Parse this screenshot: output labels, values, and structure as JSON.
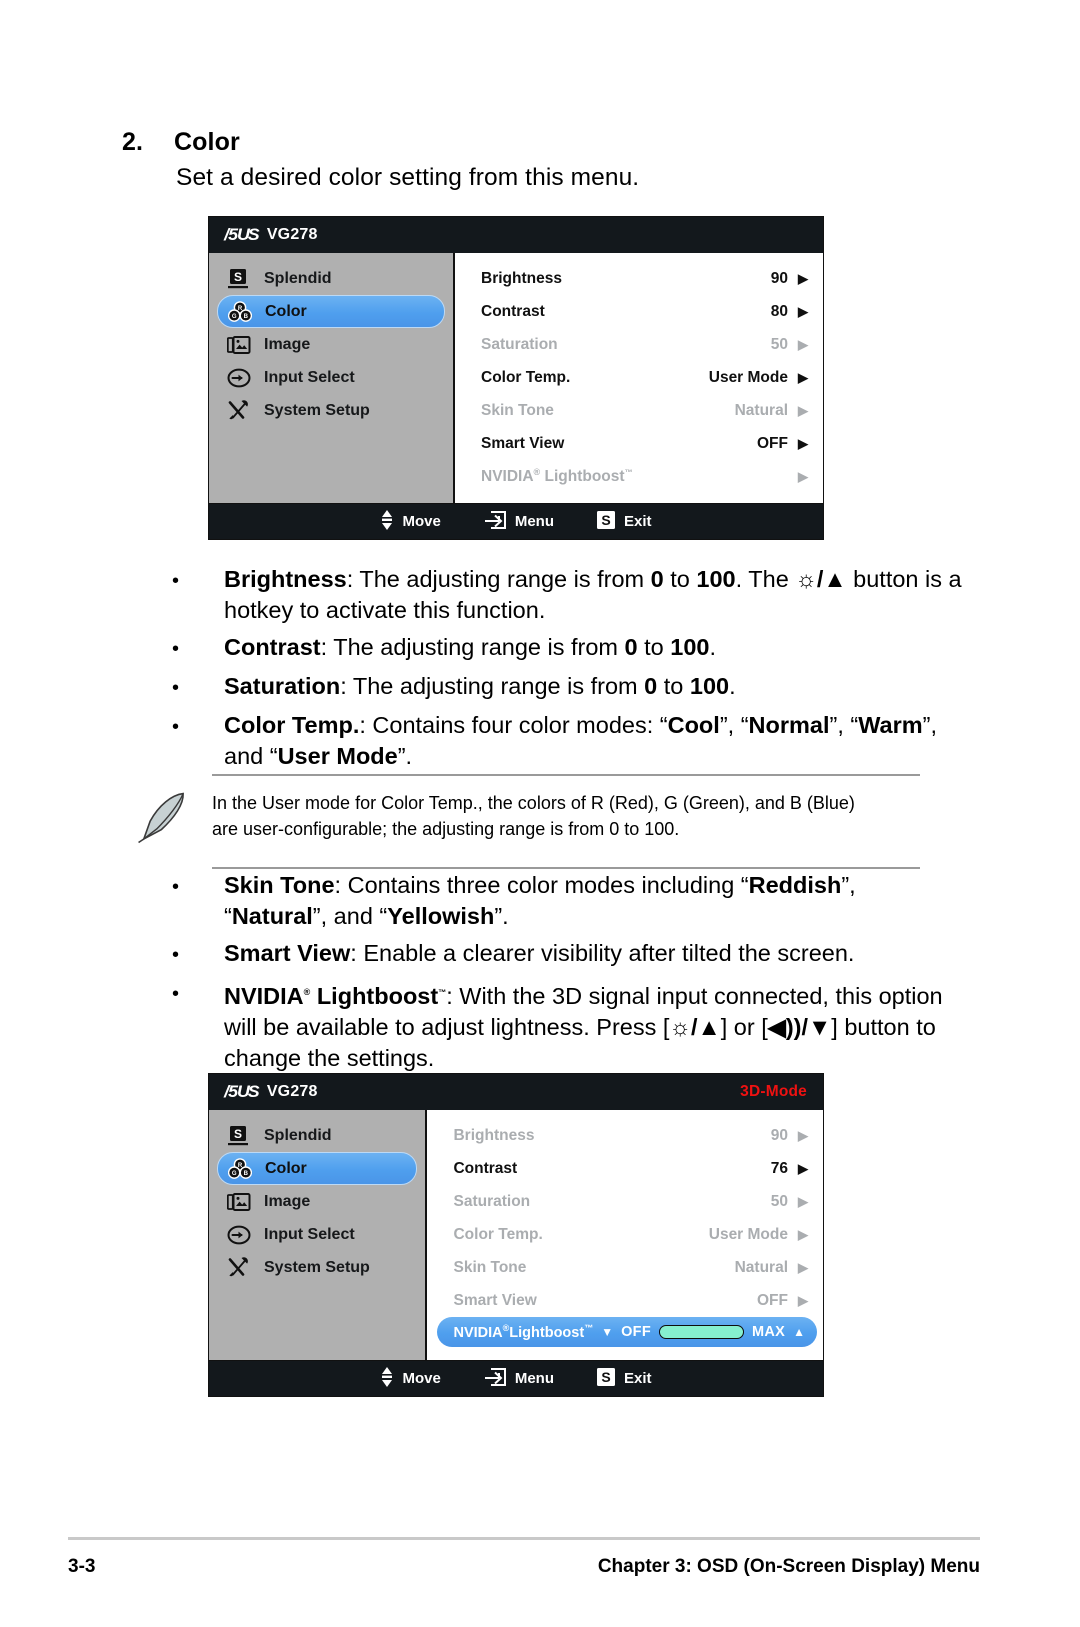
{
  "section": {
    "number": "2.",
    "title": "Color",
    "subtitle": "Set a desired color setting from this menu."
  },
  "osd_menu_1": {
    "brand": "/5US",
    "model": "VG278",
    "mode_badge": "",
    "sidebar": [
      {
        "label": "Splendid",
        "icon": "splendid-icon",
        "active": false
      },
      {
        "label": "Color",
        "icon": "color-icon",
        "active": true
      },
      {
        "label": "Image",
        "icon": "image-icon",
        "active": false
      },
      {
        "label": "Input Select",
        "icon": "input-select-icon",
        "active": false
      },
      {
        "label": "System Setup",
        "icon": "system-setup-icon",
        "active": false
      }
    ],
    "rows": [
      {
        "label": "Brightness",
        "value": "90",
        "dim": false
      },
      {
        "label": "Contrast",
        "value": "80",
        "dim": false
      },
      {
        "label": "Saturation",
        "value": "50",
        "dim": true
      },
      {
        "label": "Color Temp.",
        "value": "User Mode",
        "dim": false
      },
      {
        "label": "Skin Tone",
        "value": "Natural",
        "dim": true
      },
      {
        "label": "Smart View",
        "value": "OFF",
        "dim": false
      },
      {
        "label": "NVIDIA® Lightboost™",
        "value": "",
        "dim": true
      }
    ],
    "footer": [
      {
        "label": "Move",
        "icon": "up-down-arrows-icon"
      },
      {
        "label": "Menu",
        "icon": "enter-menu-icon"
      },
      {
        "label": "Exit",
        "icon": "s-button-icon"
      }
    ]
  },
  "osd_menu_2": {
    "brand": "/5US",
    "model": "VG278",
    "mode_badge": "3D-Mode",
    "sidebar": [
      {
        "label": "Splendid",
        "icon": "splendid-icon",
        "active": false
      },
      {
        "label": "Color",
        "icon": "color-icon",
        "active": true
      },
      {
        "label": "Image",
        "icon": "image-icon",
        "active": false
      },
      {
        "label": "Input Select",
        "icon": "input-select-icon",
        "active": false
      },
      {
        "label": "System Setup",
        "icon": "system-setup-icon",
        "active": false
      }
    ],
    "rows": [
      {
        "label": "Brightness",
        "value": "90",
        "dim": true
      },
      {
        "label": "Contrast",
        "value": "76",
        "dim": false
      },
      {
        "label": "Saturation",
        "value": "50",
        "dim": true
      },
      {
        "label": "Color Temp.",
        "value": "User Mode",
        "dim": true
      },
      {
        "label": "Skin Tone",
        "value": "Natural",
        "dim": true
      },
      {
        "label": "Smart View",
        "value": "OFF",
        "dim": true
      }
    ],
    "lightboost_row": {
      "name": "NVIDIA",
      "name2": "Lightboost",
      "down_arrow": "▼",
      "min_label": "OFF",
      "max_label": "MAX",
      "up_arrow": "▲",
      "slider_fill_percent": 100,
      "slider_color": "#86f0cf"
    },
    "footer": [
      {
        "label": "Move",
        "icon": "up-down-arrows-icon"
      },
      {
        "label": "Menu",
        "icon": "enter-menu-icon"
      },
      {
        "label": "Exit",
        "icon": "s-button-icon"
      }
    ]
  },
  "bullets_group_1": [
    {
      "term": "Brightness",
      "rest": ": The adjusting range is from ",
      "b1": "0",
      "mid": " to ",
      "b2": "100",
      "tail": ". The ",
      "glyph": "☼/▲",
      "tail2": " button is a hotkey to activate this function."
    },
    {
      "term": "Contrast",
      "rest": ": The adjusting range is from ",
      "b1": "0",
      "mid": " to ",
      "b2": "100",
      "tail": ".",
      "glyph": "",
      "tail2": ""
    },
    {
      "term": "Saturation",
      "rest": ": The adjusting range is from ",
      "b1": "0",
      "mid": " to ",
      "b2": "100",
      "tail": ".",
      "glyph": "",
      "tail2": ""
    }
  ],
  "bullet_color_temp": {
    "term": "Color Temp.",
    "rest": ": Contains four color modes: “",
    "m1": "Cool",
    "s1": "”, “",
    "m2": "Normal",
    "s2": "”, “",
    "m3": "Warm",
    "s3": "”, and “",
    "m4": "User Mode",
    "s4": "”."
  },
  "note": {
    "line1": "In the User mode for Color Temp., the colors of R (Red), G (Green), and B (Blue)",
    "line2": "are user-configurable; the adjusting range is from 0 to 100."
  },
  "bullet_skin_tone": {
    "term": "Skin Tone",
    "rest": ": Contains three color modes including “",
    "m1": "Reddish",
    "s1": "”, “",
    "m2": "Natural",
    "s2": "”, and “",
    "m3": "Yellowish",
    "s3": "”."
  },
  "bullet_smart_view": {
    "term": "Smart View",
    "rest": ": Enable a clearer visibility after tilted the screen."
  },
  "bullet_lightboost": {
    "term": "NVIDIA",
    "reg": "®",
    "term2": " Lightboost",
    "tm": "™",
    "rest": ": With the 3D signal input connected, this option will be available to adjust lightness. Press [",
    "glyph1": "☼/▲",
    "mid": "] or [",
    "glyph2": "◀))",
    "glyph3": "/▼",
    "tail": "] button to change the settings."
  },
  "page_footer": {
    "page_number": "3-3",
    "chapter": "Chapter 3: OSD (On-Screen Display) Menu"
  },
  "colors": {
    "osd_titlebar": "#13181c",
    "osd_sidebar": "#b0b0b0",
    "highlight_blue": "#4f9fee",
    "mode_red": "#ee1111",
    "slider_green": "#86f0cf",
    "dim_text": "#aaadb0"
  }
}
